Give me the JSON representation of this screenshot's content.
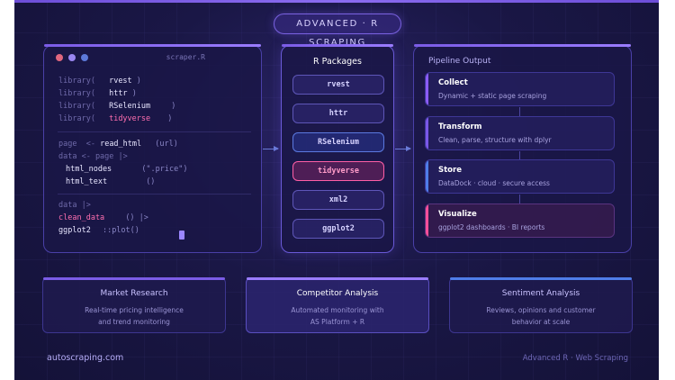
{
  "badge": "ADVANCED · R SCRAPING",
  "code": {
    "title": "scraper.R",
    "lines": [
      {
        "kw": "library(",
        "fn": "rvest",
        "end": ")"
      },
      {
        "kw": "library(",
        "fn": "httr",
        "end": ")"
      },
      {
        "kw": "library(",
        "fn": "RSelenium",
        "end": ")"
      },
      {
        "kw": "library(",
        "fn": "tidyverse",
        "end": ")"
      },
      {
        "kw": "page  <-",
        "fn": "read_html",
        "end": "(url)"
      },
      {
        "kw": "data <- page |>",
        "fn": "",
        "end": ""
      },
      {
        "kw": "",
        "fn": "html_nodes",
        "end": "(\".price\")"
      },
      {
        "kw": "",
        "fn": "html_text",
        "end": "()"
      },
      {
        "kw": "data |>",
        "fn": "",
        "end": ""
      },
      {
        "kw": "",
        "fn": "clean_data",
        "end": "() |>"
      },
      {
        "kw": "",
        "fn": "ggplot2",
        "end": "::plot()"
      }
    ]
  },
  "packages": {
    "title": "R Packages",
    "items": [
      "rvest",
      "httr",
      "RSelenium",
      "tidyverse",
      "xml2",
      "ggplot2"
    ]
  },
  "pipeline": {
    "title": "Pipeline Output",
    "steps": [
      {
        "title": "Collect",
        "desc": "Dynamic + static page scraping",
        "color": "#8a5cf6"
      },
      {
        "title": "Transform",
        "desc": "Clean, parse, structure with dplyr",
        "color": "#7a58e8"
      },
      {
        "title": "Store",
        "desc": "DataDock · cloud · secure access",
        "color": "#4f7de8"
      },
      {
        "title": "Visualize",
        "desc": "ggplot2 dashboards · BI reports",
        "color": "#ff4f9a"
      }
    ]
  },
  "cards": [
    {
      "title": "Market Research",
      "line1": "Real-time pricing intelligence",
      "line2": "and trend monitoring"
    },
    {
      "title": "Competitor Analysis",
      "line1": "Automated monitoring with",
      "line2": "AS Platform + R"
    },
    {
      "title": "Sentiment Analysis",
      "line1": "Reviews, opinions and customer",
      "line2": "behavior at scale"
    }
  ],
  "footer": {
    "left": "autoscraping.com",
    "right": "Advanced R · Web Scraping"
  },
  "colors": {
    "accent": "#7b5ce6",
    "pink": "#ff6fb0",
    "blue": "#4f7de8"
  }
}
